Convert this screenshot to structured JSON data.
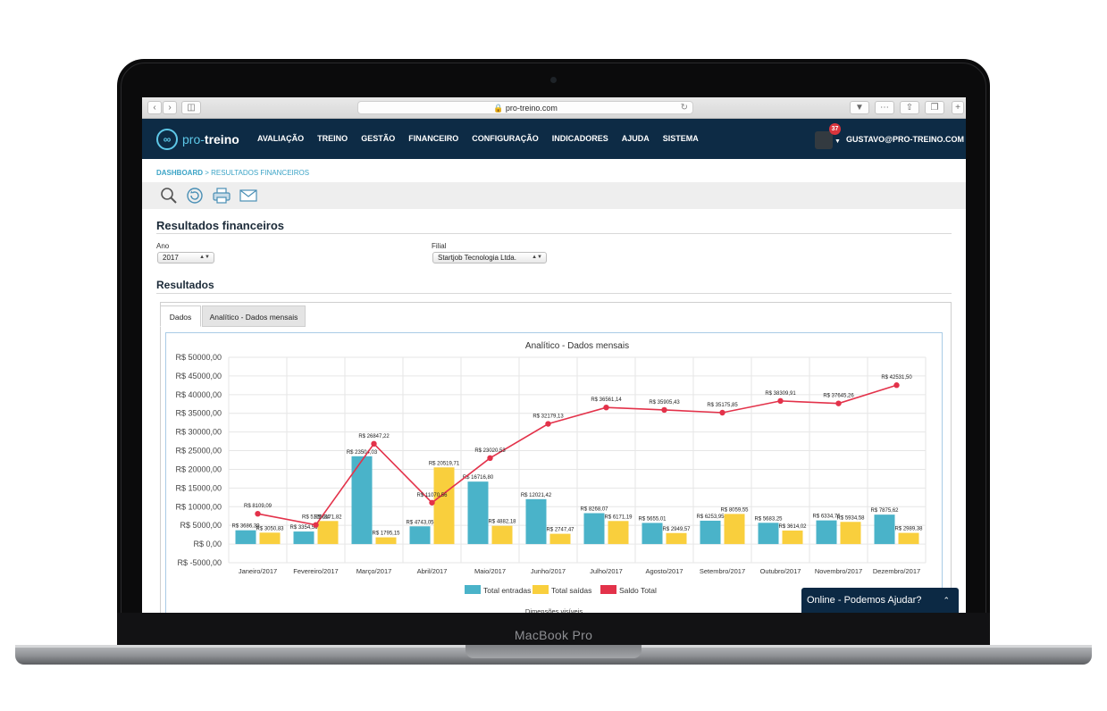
{
  "device": {
    "brand": "MacBook Pro"
  },
  "browser": {
    "url": "pro-treino.com"
  },
  "app": {
    "logo_a": "pro-",
    "logo_b": "treino",
    "menu": [
      "AVALIAÇÃO",
      "TREINO",
      "GESTÃO",
      "FINANCEIRO",
      "CONFIGURAÇÃO",
      "INDICADORES",
      "AJUDA",
      "SISTEMA"
    ],
    "notifications": "37",
    "user": "GUSTAVO@PRO-TREINO.COM"
  },
  "breadcrumb": {
    "home": "DASHBOARD",
    "separator": ">",
    "current": "RESULTADOS FINANCEIROS"
  },
  "toolbar_icons": [
    "search-icon",
    "refresh-icon",
    "print-icon",
    "email-icon"
  ],
  "page": {
    "title": "Resultados financeiros",
    "year_label": "Ano",
    "year_value": "2017",
    "branch_label": "Filial",
    "branch_value": "Startjob Tecnologia Ltda.",
    "results_title": "Resultados",
    "tabs": [
      "Dados",
      "Analítico - Dados mensais"
    ]
  },
  "chat": {
    "label": "Online - Podemos Ajudar?"
  },
  "colors": {
    "entradas": "#4ab3c9",
    "saidas": "#f9cf3d",
    "saldo": "#e3324a",
    "nav": "#0d2b45",
    "accent": "#3aa3c6"
  },
  "chart_data": {
    "type": "bar",
    "title": "Analítico - Dados mensais",
    "categories": [
      "Janeiro/2017",
      "Fevereiro/2017",
      "Março/2017",
      "Abril/2017",
      "Maio/2017",
      "Junho/2017",
      "Julho/2017",
      "Agosto/2017",
      "Setembro/2017",
      "Outubro/2017",
      "Novembro/2017",
      "Dezembro/2017"
    ],
    "series": [
      {
        "name": "Total entradas",
        "kind": "bar",
        "values": [
          3686.39,
          3354.56,
          23504.03,
          4743.05,
          16716.8,
          12021.42,
          8268.07,
          5655.01,
          6253.95,
          5683.25,
          6334.76,
          7875.62
        ]
      },
      {
        "name": "Total saídas",
        "kind": "bar",
        "values": [
          3050.83,
          6171.82,
          1795.15,
          20519.71,
          4882.18,
          2747.47,
          6171.19,
          2949.57,
          8059.55,
          3614.02,
          5934.58,
          2989.38
        ]
      },
      {
        "name": "Saldo Total",
        "kind": "line",
        "values": [
          8109.09,
          5125.34,
          26847.22,
          11070.56,
          23020.53,
          32179.13,
          36561.14,
          35905.43,
          35175.85,
          38309.91,
          37645.26,
          42531.5
        ]
      }
    ],
    "data_labels": [
      [
        "R$ 3686,39",
        "R$ 3354,56",
        "R$ 23504,03",
        "R$ 4743,05",
        "R$ 16716,80",
        "R$ 12021,42",
        "R$ 8268,07",
        "R$ 5655,01",
        "R$ 6253,95",
        "R$ 5683,25",
        "R$ 6334,76",
        "R$ 7875,62"
      ],
      [
        "R$ 3050,83",
        "R$ 6171,82",
        "R$ 1795,15",
        "R$ 20519,71",
        "R$ 4882,18",
        "R$ 2747,47",
        "R$ 6171,19",
        "R$ 2949,57",
        "R$ 8059,55",
        "R$ 3614,02",
        "R$ 5934,58",
        "R$ 2989,38"
      ],
      [
        "R$ 8109,09",
        "R$ 5125,34",
        "R$ 26847,22",
        "R$ 11070,56",
        "R$ 23020,53",
        "R$ 32179,13",
        "R$ 36561,14",
        "R$ 35905,43",
        "R$ 35175,85",
        "R$ 38309,91",
        "R$ 37645,26",
        "R$ 42531,50"
      ]
    ],
    "y_ticks": [
      "R$ 50000,00",
      "R$ 45000,00",
      "R$ 40000,00",
      "R$ 35000,00",
      "R$ 30000,00",
      "R$ 25000,00",
      "R$ 20000,00",
      "R$ 15000,00",
      "R$ 10000,00",
      "R$ 5000,00",
      "R$ 0,00",
      "R$ -5000,00"
    ],
    "ylim": [
      -5000,
      50000
    ],
    "grid": true,
    "legend_position": "bottom",
    "footer_text": "Dimensões visíveis"
  }
}
